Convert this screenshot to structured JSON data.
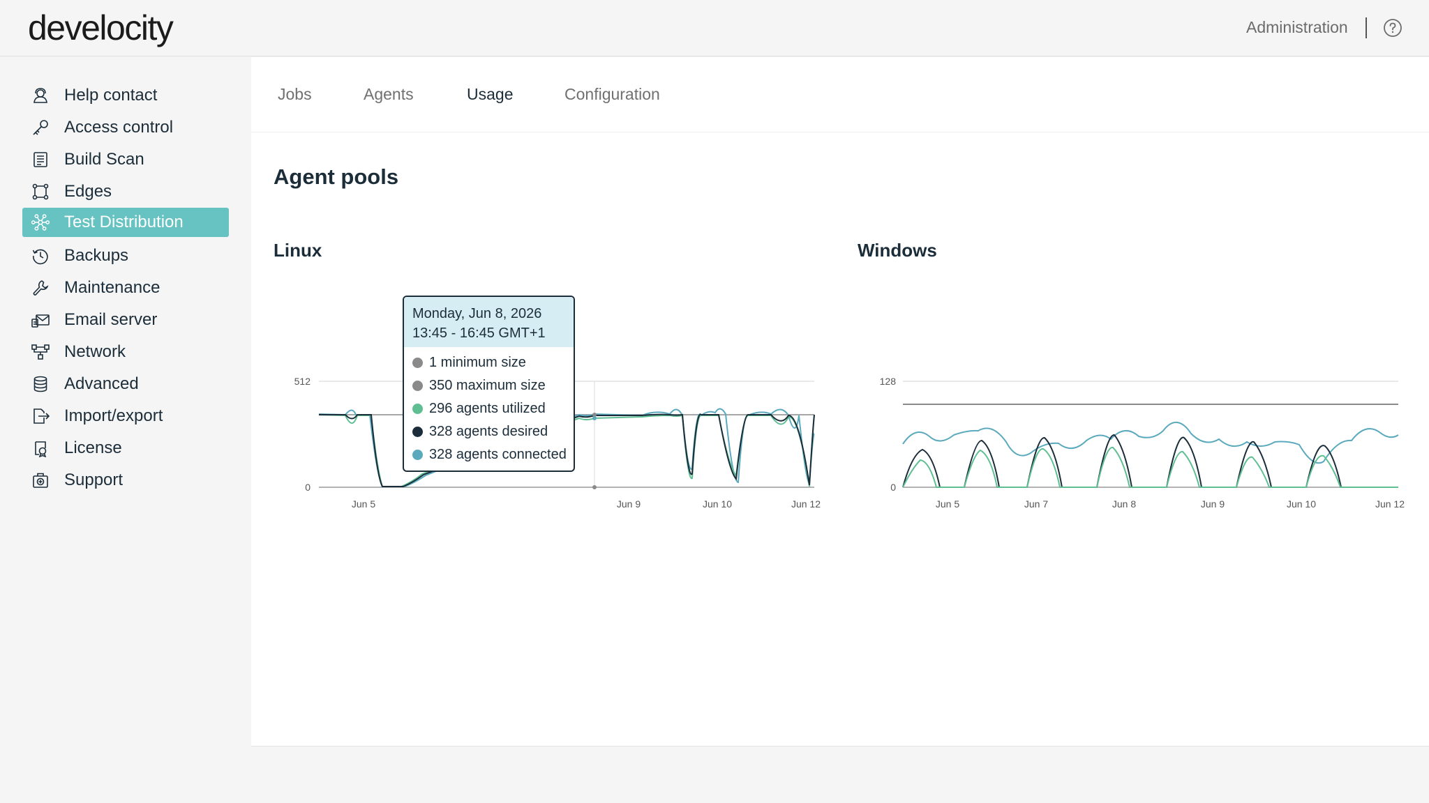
{
  "header": {
    "logo": "develocity",
    "admin_link": "Administration",
    "help": "help"
  },
  "sidebar": {
    "items": [
      {
        "label": "Help contact",
        "icon": "person-icon"
      },
      {
        "label": "Access control",
        "icon": "key-icon"
      },
      {
        "label": "Build Scan",
        "icon": "list-icon"
      },
      {
        "label": "Edges",
        "icon": "edges-icon"
      },
      {
        "label": "Test Distribution",
        "icon": "distribution-icon",
        "active": true
      },
      {
        "label": "Backups",
        "icon": "history-icon"
      },
      {
        "label": "Maintenance",
        "icon": "wrench-icon"
      },
      {
        "label": "Email server",
        "icon": "email-icon"
      },
      {
        "label": "Network",
        "icon": "network-icon"
      },
      {
        "label": "Advanced",
        "icon": "database-icon"
      },
      {
        "label": "Import/export",
        "icon": "import-export-icon"
      },
      {
        "label": "License",
        "icon": "license-icon"
      },
      {
        "label": "Support",
        "icon": "support-icon"
      }
    ]
  },
  "tabs": [
    {
      "label": "Jobs"
    },
    {
      "label": "Agents"
    },
    {
      "label": "Usage",
      "active": true
    },
    {
      "label": "Configuration"
    }
  ],
  "page_title": "Agent pools",
  "colors": {
    "accent": "#66c3c2",
    "min_max": "#8a8a8a",
    "utilized": "#5fbf93",
    "desired": "#1b2d3a",
    "connected": "#5aa9bd"
  },
  "tooltip": {
    "date": "Monday, Jun 8, 2026",
    "time": "13:45 - 16:45 GMT+1",
    "rows": [
      {
        "text": "1 minimum size",
        "color": "#8a8a8a"
      },
      {
        "text": "350 maximum size",
        "color": "#8a8a8a"
      },
      {
        "text": "296 agents utilized",
        "color": "#5fbf93"
      },
      {
        "text": "328 agents desired",
        "color": "#1b2d3a"
      },
      {
        "text": "328 agents connected",
        "color": "#5aa9bd"
      }
    ]
  },
  "chart_data": [
    {
      "type": "line",
      "title": "Linux",
      "yticks": [
        "512",
        "0"
      ],
      "ylim": [
        0,
        512
      ],
      "xticks": [
        "Jun 5",
        "Jun 9",
        "Jun 10",
        "Jun 12"
      ],
      "series": [
        {
          "name": "minimum size",
          "values": [
            1
          ]
        },
        {
          "name": "maximum size",
          "values": [
            350
          ]
        },
        {
          "name": "agents utilized",
          "values": [
            296
          ]
        },
        {
          "name": "agents desired",
          "values": [
            328
          ]
        },
        {
          "name": "agents connected",
          "values": [
            328
          ]
        }
      ]
    },
    {
      "type": "line",
      "title": "Windows",
      "yticks": [
        "128",
        "0"
      ],
      "ylim": [
        0,
        128
      ],
      "xticks": [
        "Jun 5",
        "Jun 7",
        "Jun 8",
        "Jun 9",
        "Jun 10",
        "Jun 12"
      ],
      "series": [
        {
          "name": "maximum size",
          "values": [
            98
          ]
        }
      ]
    }
  ]
}
